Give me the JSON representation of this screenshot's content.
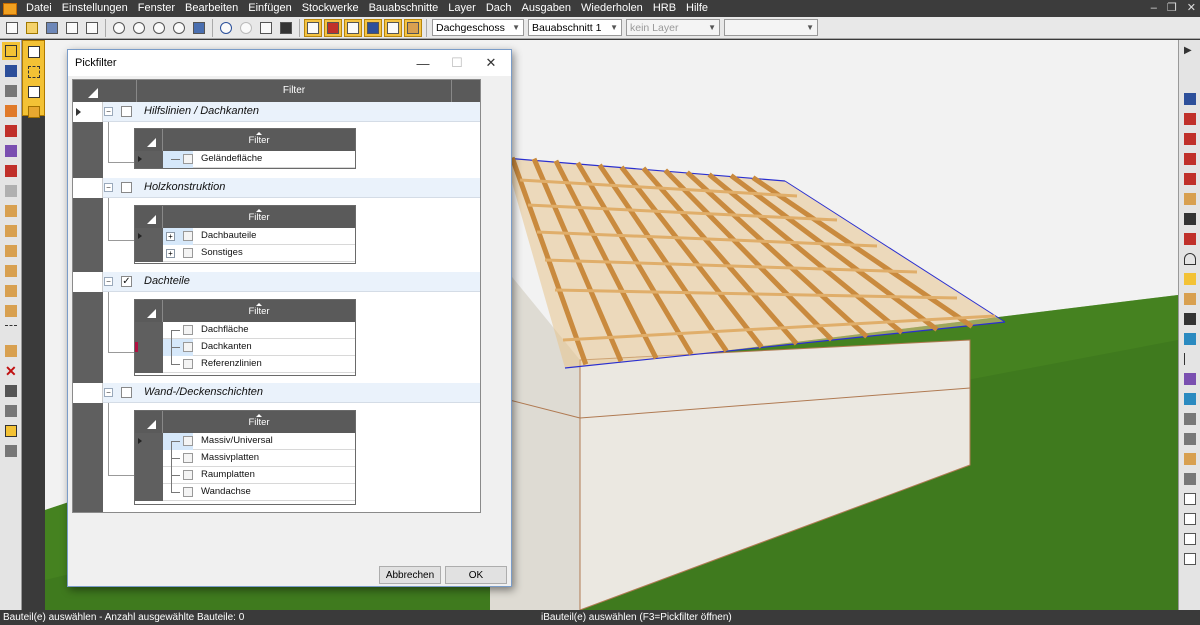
{
  "menubar": {
    "items": [
      "Datei",
      "Einstellungen",
      "Fenster",
      "Bearbeiten",
      "Einfügen",
      "Stockwerke",
      "Bauabschnitte",
      "Layer",
      "Dach",
      "Ausgaben",
      "Wiederholen",
      "HRB",
      "Hilfe"
    ],
    "window_controls": [
      "–",
      "❐",
      "✕"
    ]
  },
  "toolbar": {
    "storey_value": "Dachgeschoss",
    "section_value": "Bauabschnitt 1",
    "layer_value": "kein Layer",
    "extra_value": ""
  },
  "dialog": {
    "title": "Pickfilter",
    "header_label": "Filter",
    "minimize": "—",
    "maximize": "☐",
    "close": "✕",
    "groups": [
      {
        "label": "Hilfslinien / Dachkanten",
        "checked": "",
        "sub_header": "Filter",
        "rows": [
          {
            "label": "Geländefläche"
          }
        ]
      },
      {
        "label": "Holzkonstruktion",
        "checked": "",
        "sub_header": "Filter",
        "rows": [
          {
            "label": "Dachbauteile",
            "expander": "+"
          },
          {
            "label": "Sonstiges",
            "expander": "+"
          }
        ]
      },
      {
        "label": "Dachteile",
        "checked": "✓",
        "sub_header": "Filter",
        "rows": [
          {
            "label": "Dachfläche"
          },
          {
            "label": "Dachkanten"
          },
          {
            "label": "Referenzlinien"
          }
        ]
      },
      {
        "label": "Wand-/Deckenschichten",
        "checked": "",
        "sub_header": "Filter",
        "rows": [
          {
            "label": "Massiv/Universal"
          },
          {
            "label": "Massivplatten"
          },
          {
            "label": "Raumplatten"
          },
          {
            "label": "Wandachse"
          }
        ]
      }
    ],
    "cancel_label": "Abbrechen",
    "ok_label": "OK"
  },
  "statusbar": {
    "left_text": "Bauteil(e) auswählen -  Anzahl ausgewählte Bauteile: 0",
    "center_text": "iBauteil(e) auswählen (F3=Pickfilter öffnen)"
  },
  "colors": {
    "sky": "#f2f2f2",
    "grass": "#3f7a1e",
    "wall": "#e9e6df",
    "timber": "#d9a45c",
    "accent": "#f3c235"
  }
}
